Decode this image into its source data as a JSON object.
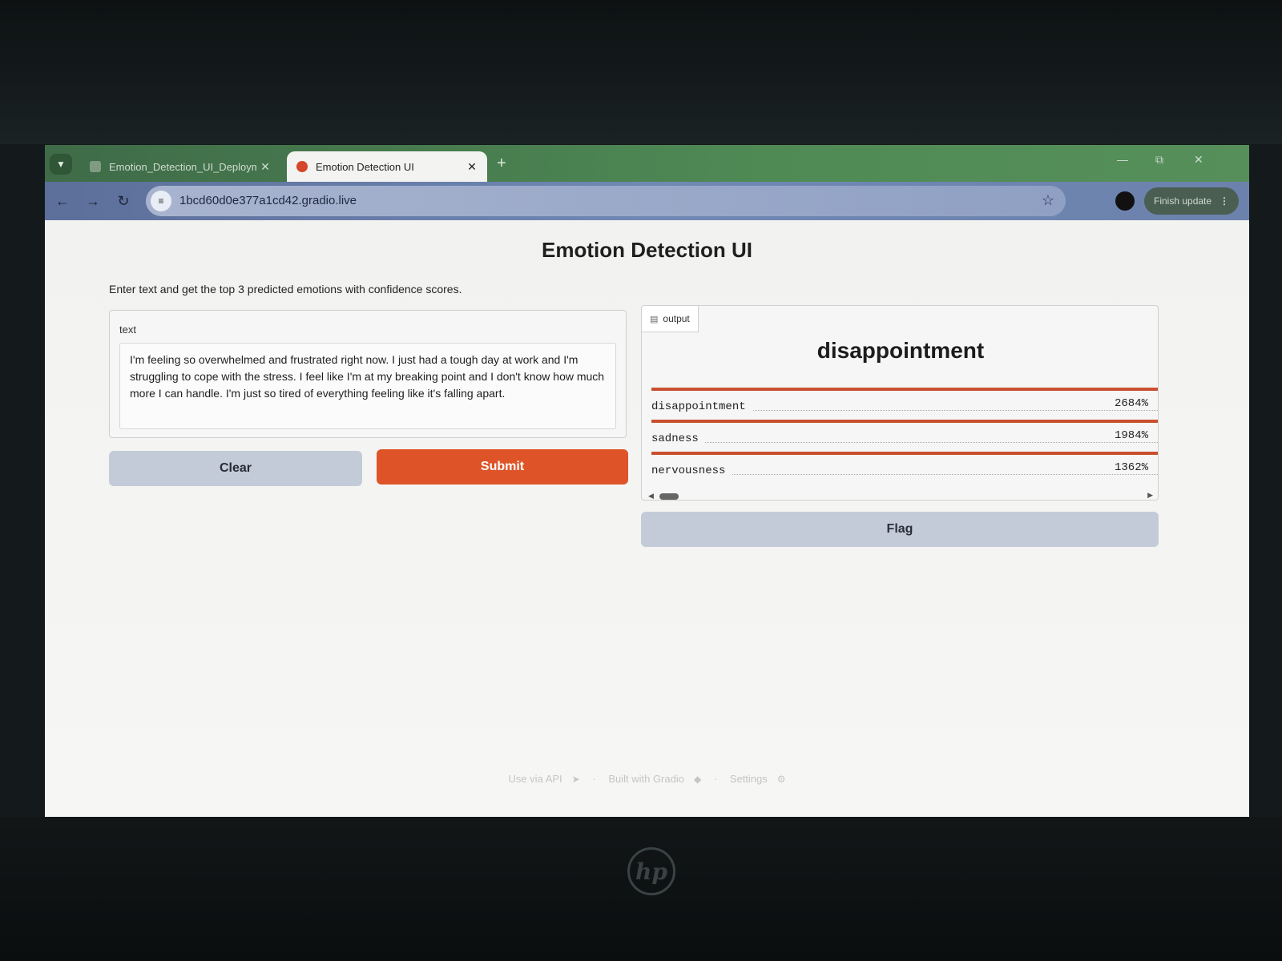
{
  "browser": {
    "tabs": [
      {
        "title": "Emotion_Detection_UI_Deploym",
        "active": false
      },
      {
        "title": "Emotion Detection UI",
        "active": true
      }
    ],
    "url": "1bcd60d0e377a1cd42.gradio.live",
    "finish_update_label": "Finish update",
    "brand_color": "#de5428"
  },
  "page": {
    "title": "Emotion Detection UI",
    "description": "Enter text and get the top 3 predicted emotions with confidence scores.",
    "input": {
      "label": "text",
      "value": "I'm feeling so overwhelmed and frustrated right now. I just had a tough day at work and I'm struggling to cope with the stress. I feel like I'm at my breaking point and I don't know how much more I can handle. I'm just so tired of everything feeling like it's falling apart."
    },
    "buttons": {
      "clear": "Clear",
      "submit": "Submit",
      "flag": "Flag"
    },
    "output": {
      "label": "output",
      "top_prediction": "disappointment",
      "confidences": [
        {
          "label": "disappointment",
          "value": "2684%",
          "fill": 1.0
        },
        {
          "label": "sadness",
          "value": "1984%",
          "fill": 1.0
        },
        {
          "label": "nervousness",
          "value": "1362%",
          "fill": 1.0
        }
      ]
    },
    "footer": {
      "api": "Use via API",
      "built": "Built with Gradio",
      "settings": "Settings"
    }
  }
}
